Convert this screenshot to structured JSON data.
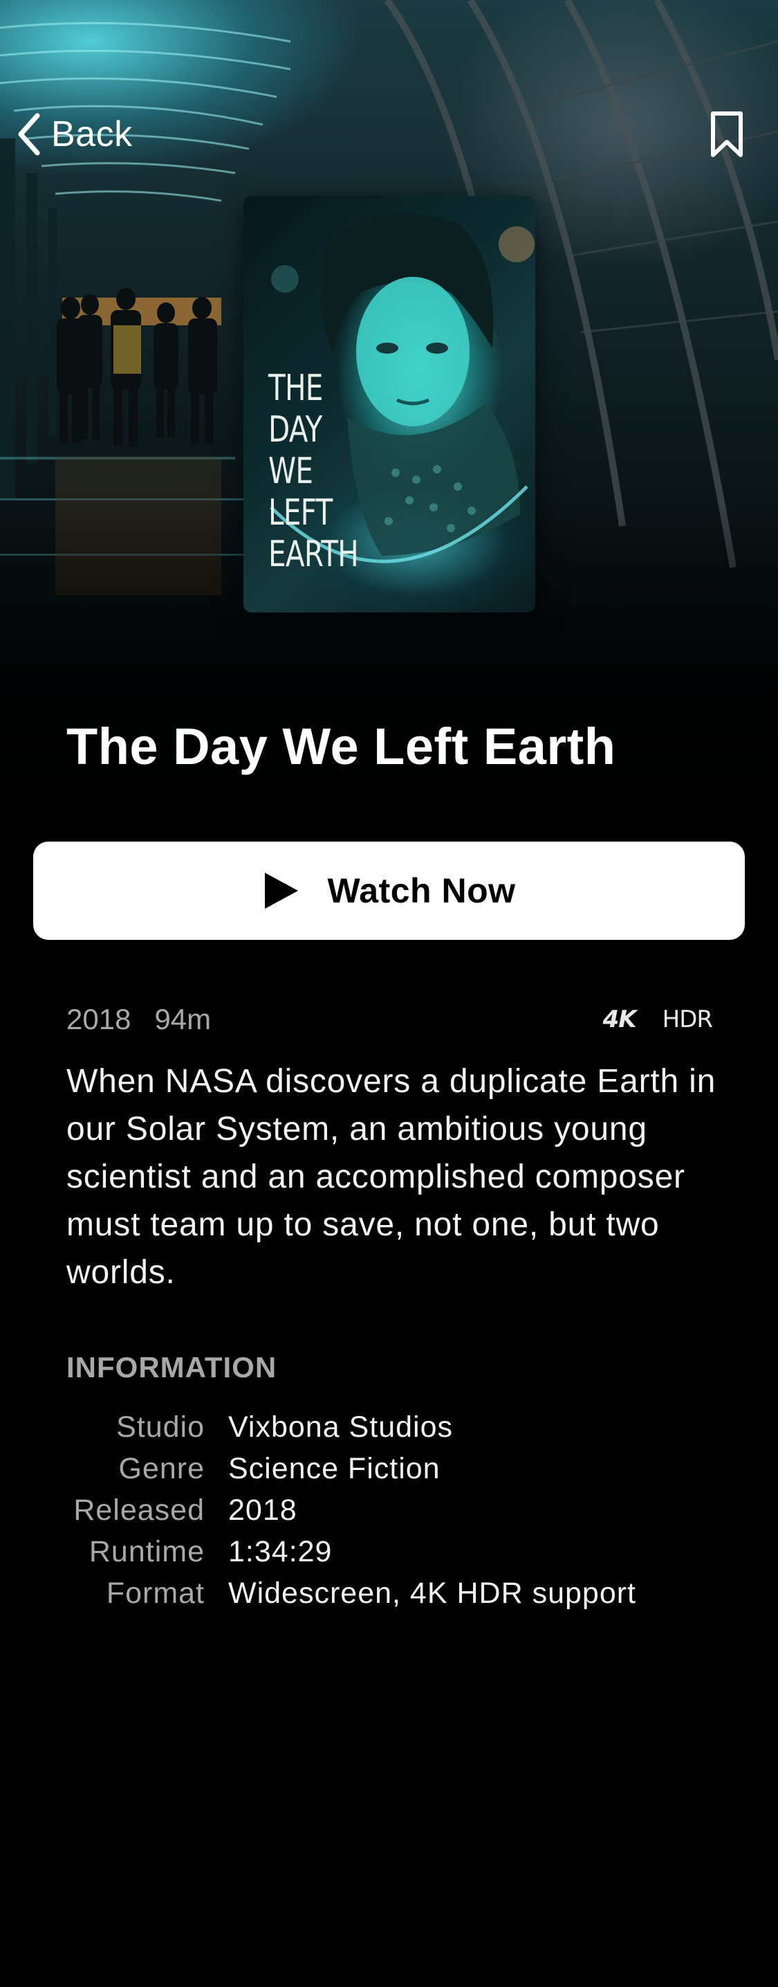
{
  "nav": {
    "back_label": "Back"
  },
  "poster": {
    "title_lines": [
      "THE",
      "DAY",
      "WE",
      "LEFT",
      "EARTH"
    ]
  },
  "movie": {
    "title": "The Day We Left Earth",
    "watch_label": "Watch Now",
    "year": "2018",
    "duration": "94m",
    "badges": {
      "quality": "4K",
      "range": "HDR"
    },
    "description": "When NASA discovers a duplicate Earth in our Solar System, an ambitious young scientist and an accomplished composer must team up to save, not one, but two worlds."
  },
  "information": {
    "heading": "INFORMATION",
    "rows": [
      {
        "key": "Studio",
        "value": "Vixbona Studios"
      },
      {
        "key": "Genre",
        "value": "Science Fiction"
      },
      {
        "key": "Released",
        "value": "2018"
      },
      {
        "key": "Runtime",
        "value": "1:34:29"
      },
      {
        "key": "Format",
        "value": "Widescreen, 4K HDR support"
      }
    ]
  },
  "colors": {
    "background": "#000000",
    "button_bg": "#ffffff",
    "muted_text": "#a8a8a8",
    "accent_teal": "#3ee0d8"
  }
}
